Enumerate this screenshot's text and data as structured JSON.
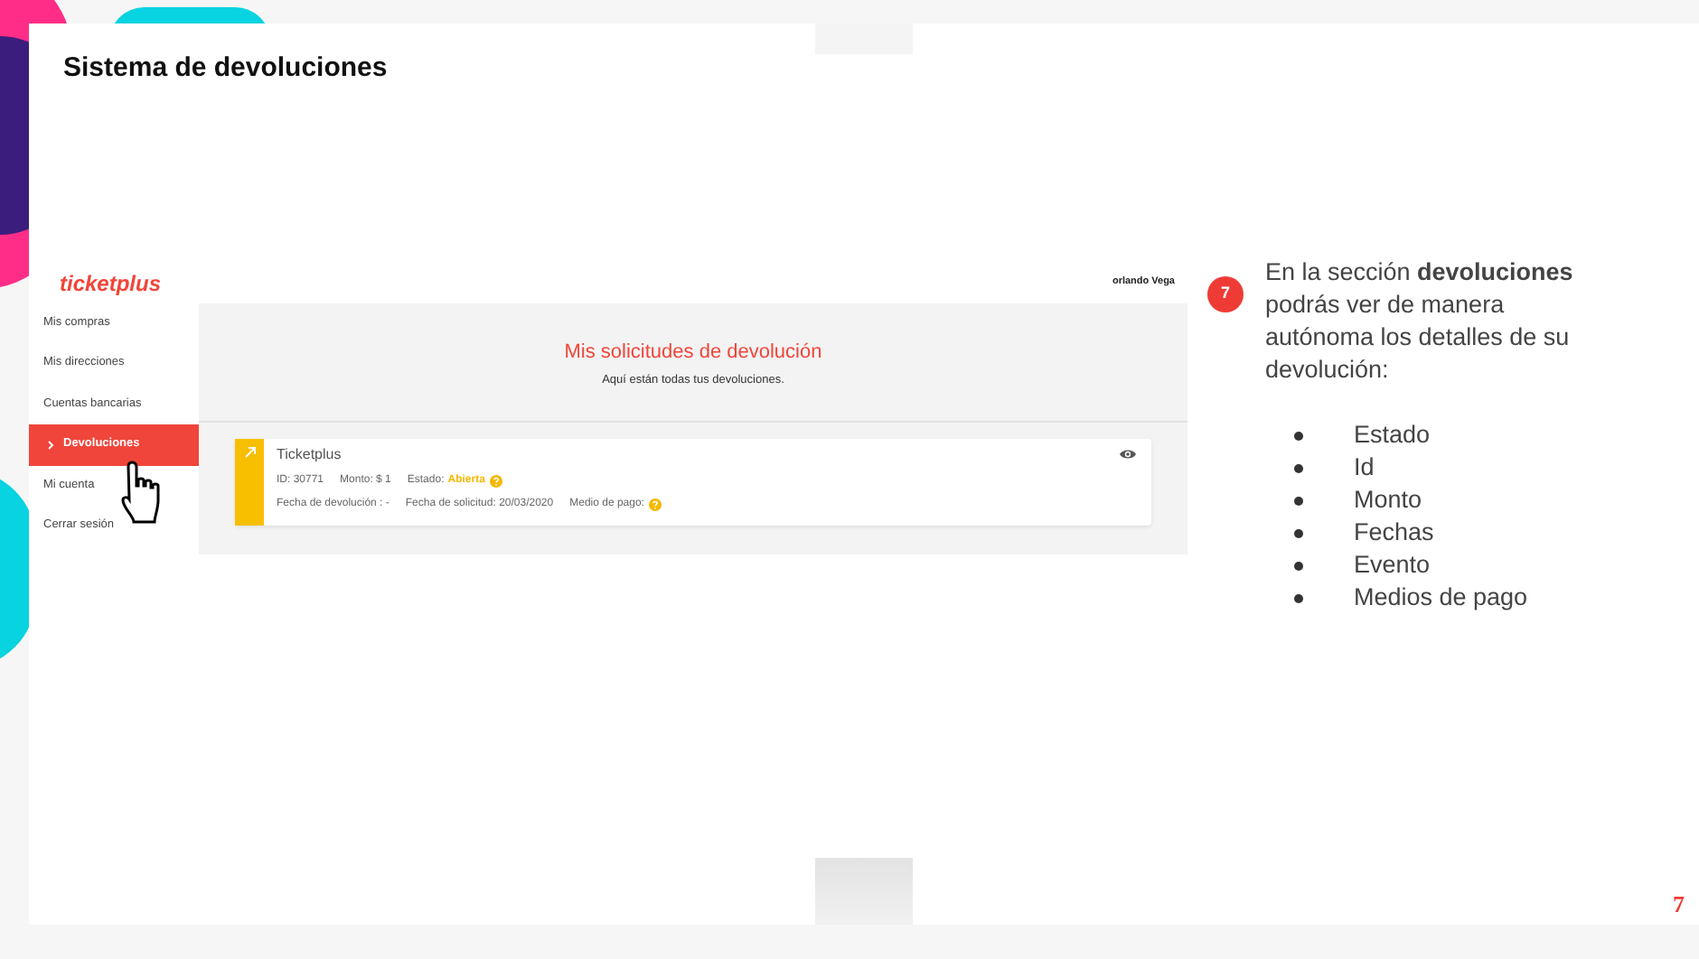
{
  "slide_title": "Sistema de devoluciones",
  "app": {
    "logo": "ticketplus",
    "user": "orlando Vega",
    "sidebar": [
      {
        "label": "Mis compras",
        "selected": false
      },
      {
        "label": "Mis direcciones",
        "selected": false
      },
      {
        "label": "Cuentas bancarias",
        "selected": false
      },
      {
        "label": "Devoluciones",
        "selected": true
      },
      {
        "label": "Mi cuenta",
        "selected": false
      },
      {
        "label": "Cerrar sesión",
        "selected": false
      }
    ],
    "header": {
      "title": "Mis solicitudes de devolución",
      "subtitle": "Aquí están todas tus devoluciones."
    },
    "returns": [
      {
        "name": "Ticketplus",
        "first_line": [
          {
            "kind": "text",
            "label": "ID:",
            "value": "30771"
          },
          {
            "kind": "text",
            "label": "Monto:",
            "value": "$ 1"
          },
          {
            "kind": "status",
            "label": "Estado:",
            "value": "Abierta"
          }
        ],
        "second_line": [
          {
            "kind": "text",
            "label": "Fecha de devolución :",
            "value": "-"
          },
          {
            "kind": "text",
            "label": "Fecha de solicitud:",
            "value": "20/03/2020"
          },
          {
            "kind": "help",
            "label": "Medio de pago:"
          }
        ]
      }
    ]
  },
  "step": "7",
  "description": "En la sección **devoluciones** podrás ver de manera autónoma los detalles de su devolución:",
  "bullets": [
    "Estado",
    "Id",
    "Monto",
    "Fechas",
    "Evento",
    "Medios de pago"
  ],
  "page_number": "7"
}
